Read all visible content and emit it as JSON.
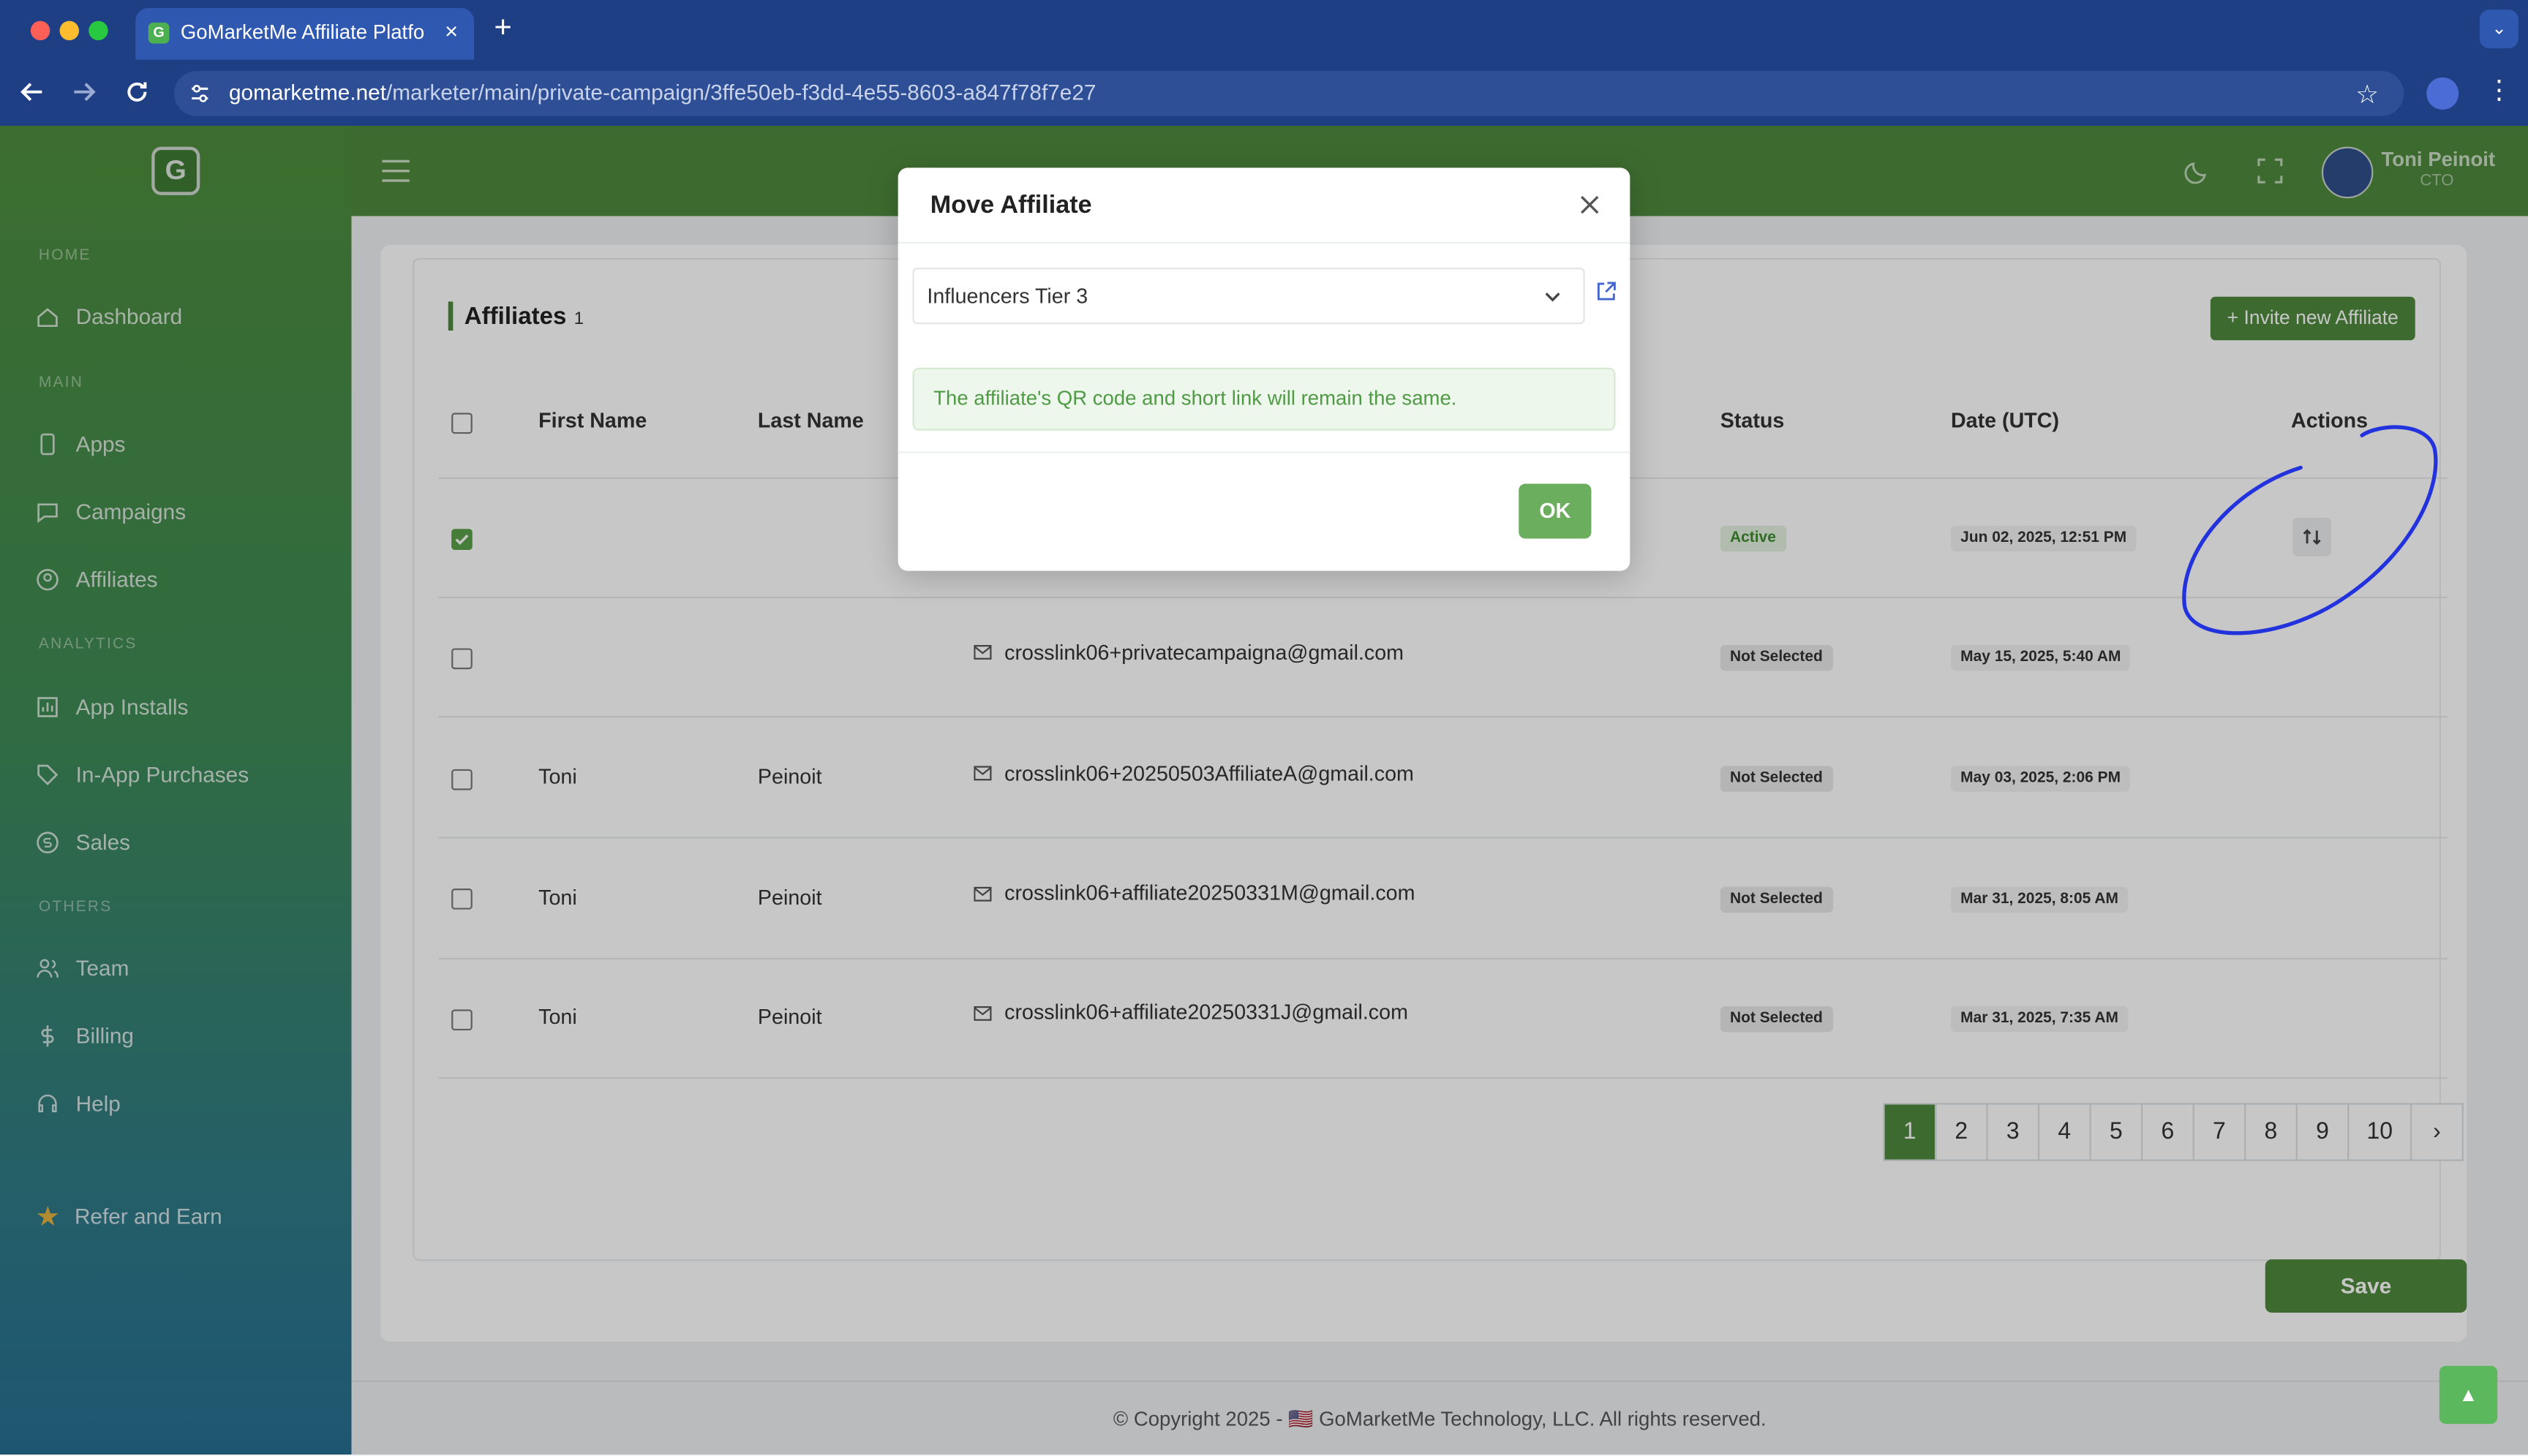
{
  "browser": {
    "tab_title": "GoMarketMe Affiliate Platform",
    "url_domain": "gomarketme.net",
    "url_path": "/marketer/main/private-campaign/3ffe50eb-f3dd-4e55-8603-a847f78f7e27"
  },
  "header": {
    "user_name": "Toni Peinoit",
    "user_role": "CTO"
  },
  "sidebar": {
    "sections": [
      "HOME",
      "MAIN",
      "ANALYTICS",
      "OTHERS"
    ],
    "items": [
      {
        "label": "Dashboard",
        "icon": "home-icon"
      },
      {
        "label": "Apps",
        "icon": "phone-icon"
      },
      {
        "label": "Campaigns",
        "icon": "chat-icon"
      },
      {
        "label": "Affiliates",
        "icon": "user-circle-icon"
      },
      {
        "label": "App Installs",
        "icon": "bar-chart-icon"
      },
      {
        "label": "In-App Purchases",
        "icon": "tag-icon"
      },
      {
        "label": "Sales",
        "icon": "coin-icon"
      },
      {
        "label": "Team",
        "icon": "team-icon"
      },
      {
        "label": "Billing",
        "icon": "dollar-icon"
      },
      {
        "label": "Help",
        "icon": "headset-icon"
      }
    ],
    "refer": "Refer and Earn"
  },
  "affiliates": {
    "title": "Affiliates",
    "count": "1",
    "invite_label": "+ Invite new Affiliate",
    "columns": {
      "first": "First Name",
      "last": "Last Name",
      "status": "Status",
      "date": "Date (UTC)",
      "actions": "Actions"
    },
    "rows": [
      {
        "first": "",
        "last": "",
        "email": "",
        "status": "Active",
        "date": "Jun 02, 2025, 12:51 PM",
        "checked": true
      },
      {
        "first": "",
        "last": "",
        "email": "crosslink06+privatecampaigna@gmail.com",
        "status": "Not Selected",
        "date": "May 15, 2025, 5:40 AM",
        "checked": false
      },
      {
        "first": "Toni",
        "last": "Peinoit",
        "email": "crosslink06+20250503AffiliateA@gmail.com",
        "status": "Not Selected",
        "date": "May 03, 2025, 2:06 PM",
        "checked": false
      },
      {
        "first": "Toni",
        "last": "Peinoit",
        "email": "crosslink06+affiliate20250331M@gmail.com",
        "status": "Not Selected",
        "date": "Mar 31, 2025, 8:05 AM",
        "checked": false
      },
      {
        "first": "Toni",
        "last": "Peinoit",
        "email": "crosslink06+affiliate20250331J@gmail.com",
        "status": "Not Selected",
        "date": "Mar 31, 2025, 7:35 AM",
        "checked": false
      }
    ],
    "pages": [
      "1",
      "2",
      "3",
      "4",
      "5",
      "6",
      "7",
      "8",
      "9",
      "10"
    ],
    "next": "›",
    "save_label": "Save"
  },
  "footer": {
    "copyright": "© Copyright 2025 - 🇺🇸 GoMarketMe Technology, LLC. All rights reserved."
  },
  "modal": {
    "title": "Move Affiliate",
    "selected_campaign": "Influencers Tier 3",
    "info": "The affiliate's QR code and short link will remain the same.",
    "ok_label": "OK"
  },
  "colors": {
    "brand_green": "#4f8a3d",
    "ok_green": "#6aae5e",
    "annotation_blue": "#2233dd"
  }
}
